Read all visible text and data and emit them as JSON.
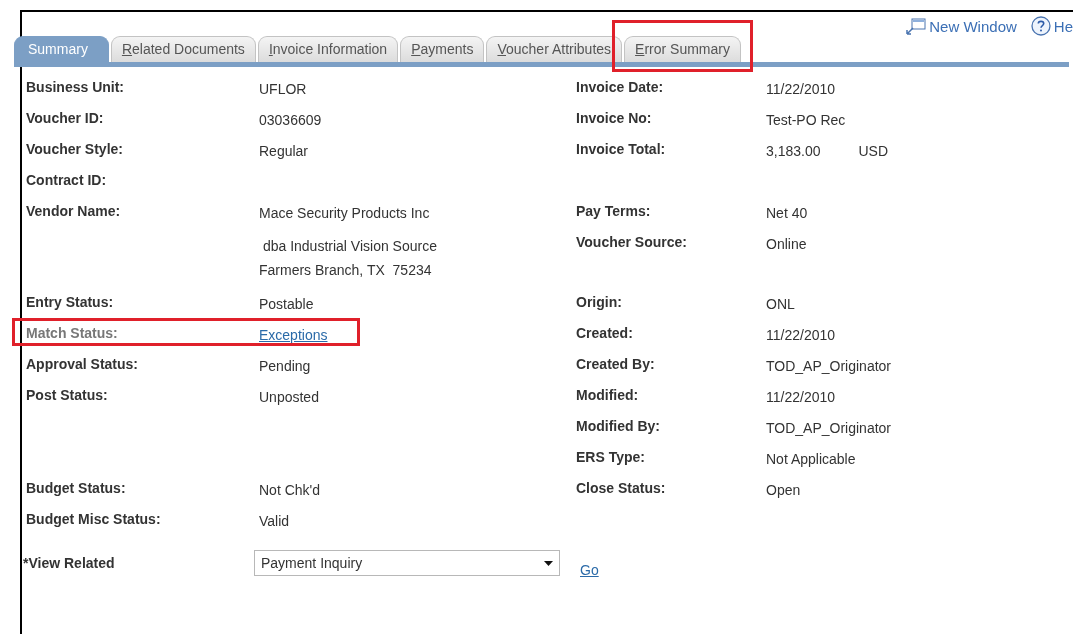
{
  "header_links": [
    {
      "kind": "new-window",
      "label": "New Window"
    },
    {
      "kind": "help",
      "label": "He"
    }
  ],
  "tabs": [
    {
      "label": "Summary",
      "selected": true,
      "highlighted": false
    },
    {
      "label": "Related Documents",
      "selected": false,
      "highlighted": false
    },
    {
      "label": "Invoice Information",
      "selected": false,
      "highlighted": false
    },
    {
      "label": "Payments",
      "selected": false,
      "highlighted": false
    },
    {
      "label": "Voucher Attributes",
      "selected": false,
      "highlighted": false
    },
    {
      "label": "Error Summary",
      "selected": false,
      "highlighted": true
    }
  ],
  "rows": [
    {
      "left": {
        "label": "Business Unit:",
        "values": [
          "UFLOR"
        ]
      },
      "right": {
        "label": "Invoice Date:",
        "values": [
          "11/22/2010"
        ]
      }
    },
    {
      "left": {
        "label": "Voucher ID:",
        "values": [
          "03036609"
        ]
      },
      "right": {
        "label": "Invoice No:",
        "values": [
          "Test-PO Rec"
        ]
      }
    },
    {
      "left": {
        "label": "Voucher Style:",
        "values": [
          "Regular"
        ]
      },
      "right": {
        "label": "Invoice Total:",
        "values": [
          "3,183.00",
          "USD"
        ]
      }
    },
    {
      "left": {
        "label": "Contract ID:"
      }
    },
    {
      "left": {
        "label": "Vendor Name:",
        "values": [
          "Mace Security Products Inc"
        ]
      },
      "right": {
        "label": "Pay Terms:",
        "values": [
          "Net 40"
        ]
      }
    },
    {
      "left": {
        "lines": [
          " dba Industrial Vision Source",
          "Farmers Branch, TX  75234"
        ]
      },
      "right": {
        "label": "Voucher Source:",
        "values": [
          "Online"
        ]
      }
    },
    {
      "left": {
        "label": "Entry Status:",
        "values": [
          "Postable"
        ]
      },
      "right": {
        "label": "Origin:",
        "values": [
          "ONL"
        ]
      }
    },
    {
      "left": {
        "label": "Match Status:",
        "values": [
          "Exceptions"
        ],
        "kind": "link",
        "dimmed": true,
        "highlighted": true
      },
      "right": {
        "label": "Created:",
        "values": [
          "11/22/2010"
        ]
      }
    },
    {
      "left": {
        "label": "Approval Status:",
        "values": [
          "Pending"
        ]
      },
      "right": {
        "label": "Created By:",
        "values": [
          "TOD_AP_Originator"
        ]
      }
    },
    {
      "left": {
        "label": "Post Status:",
        "values": [
          "Unposted"
        ]
      },
      "right": {
        "label": "Modified:",
        "values": [
          "11/22/2010"
        ]
      }
    },
    {
      "right": {
        "label": "Modified By:",
        "values": [
          "TOD_AP_Originator"
        ]
      }
    },
    {
      "right": {
        "label": "ERS Type:",
        "values": [
          "Not Applicable"
        ]
      }
    },
    {
      "left": {
        "label": "Budget Status:",
        "values": [
          "Not Chk'd"
        ]
      },
      "right": {
        "label": "Close Status:",
        "values": [
          "Open"
        ]
      }
    },
    {
      "left": {
        "label": "Budget Misc Status:",
        "values": [
          "Valid"
        ]
      }
    }
  ],
  "view_related": {
    "label": "*View Related",
    "value": "Payment Inquiry",
    "go": "Go"
  }
}
